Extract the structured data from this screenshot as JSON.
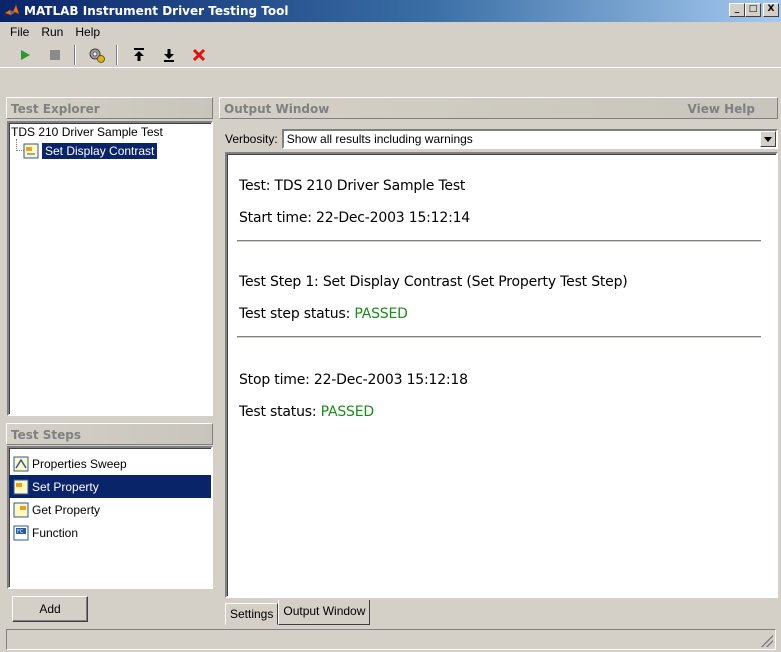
{
  "window": {
    "title": "MATLAB Instrument Driver Testing Tool",
    "min_label": "_",
    "max_label": "□",
    "close_label": "X"
  },
  "menu": {
    "file": "File",
    "run": "Run",
    "help": "Help"
  },
  "toolbar": {
    "icons": [
      "run-icon",
      "stop-icon",
      "generate-code-icon",
      "move-up-icon",
      "move-down-icon",
      "delete-icon"
    ],
    "colors": {
      "run": "#2a9a2a",
      "delete": "#e01010",
      "stop": "#808080"
    }
  },
  "explorer": {
    "header": "Test Explorer",
    "root": "TDS 210 Driver Sample Test",
    "child": "Set Display Contrast"
  },
  "steps": {
    "header": "Test Steps",
    "items": [
      {
        "label": "Properties Sweep",
        "icon": "sweep-icon"
      },
      {
        "label": "Set Property",
        "icon": "set-property-icon"
      },
      {
        "label": "Get Property",
        "icon": "get-property-icon"
      },
      {
        "label": "Function",
        "icon": "function-icon"
      }
    ],
    "selected": "Set Property",
    "add_label": "Add"
  },
  "output": {
    "header": "Output Window",
    "help": "View Help",
    "verbosity_label": "Verbosity:",
    "verbosity_value": "Show all results including warnings",
    "test_line": "Test: TDS 210 Driver Sample Test",
    "start_line": "Start time: 22-Dec-2003 15:12:14",
    "step_line": "Test Step 1: Set Display Contrast (Set Property Test Step)",
    "step_status_label": "Test step status: ",
    "step_status_value": "PASSED",
    "stop_line": "Stop time: 22-Dec-2003 15:12:18",
    "test_status_label": "Test status: ",
    "test_status_value": "PASSED",
    "passed_color": "#1a8a1a"
  },
  "tabs": {
    "settings": "Settings",
    "output": "Output Window"
  }
}
